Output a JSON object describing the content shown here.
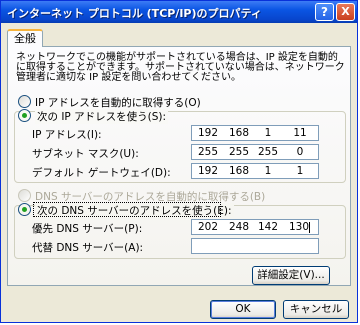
{
  "window": {
    "title": "インターネット プロトコル (TCP/IP)のプロパティ",
    "help_glyph": "?",
    "close_glyph": "X"
  },
  "tabs": [
    {
      "label": "全般",
      "selected": true
    }
  ],
  "description": "ネットワークでこの機能がサポートされている場合は、IP 設定を自動的に取得することができます。サポートされていない場合は、ネットワーク管理者に適切な IP 設定を問い合わせてください。",
  "ip_mode": {
    "auto_label": "IP アドレスを自動的に取得する(O)",
    "manual_label": "次の IP アドレスを使う(S):",
    "selected": "manual"
  },
  "ip_fields": [
    {
      "label": "IP アドレス(I):",
      "octets": [
        "192",
        "168",
        "1",
        "11"
      ]
    },
    {
      "label": "サブネット マスク(U):",
      "octets": [
        "255",
        "255",
        "255",
        "0"
      ]
    },
    {
      "label": "デフォルト ゲートウェイ(D):",
      "octets": [
        "192",
        "168",
        "1",
        "1"
      ]
    }
  ],
  "dns_mode": {
    "auto_label": "DNS サーバーのアドレスを自動的に取得する(B)",
    "manual_label": "次の DNS サーバーのアドレスを使う(E):",
    "selected": "manual",
    "auto_disabled": true
  },
  "dns_fields": [
    {
      "label": "優先 DNS サーバー(P):",
      "octets": [
        "202",
        "248",
        "142",
        "130"
      ]
    },
    {
      "label": "代替 DNS サーバー(A):",
      "octets": [
        "",
        "",
        "",
        ""
      ]
    }
  ],
  "buttons": {
    "advanced": "詳細設定(V)...",
    "ok": "OK",
    "cancel": "キャンセル"
  },
  "colors": {
    "title_bar": "#0a55e3",
    "window_bg": "#ece9d8",
    "radio_dot": "#21a121",
    "tab_highlight": "#f7b43c"
  }
}
